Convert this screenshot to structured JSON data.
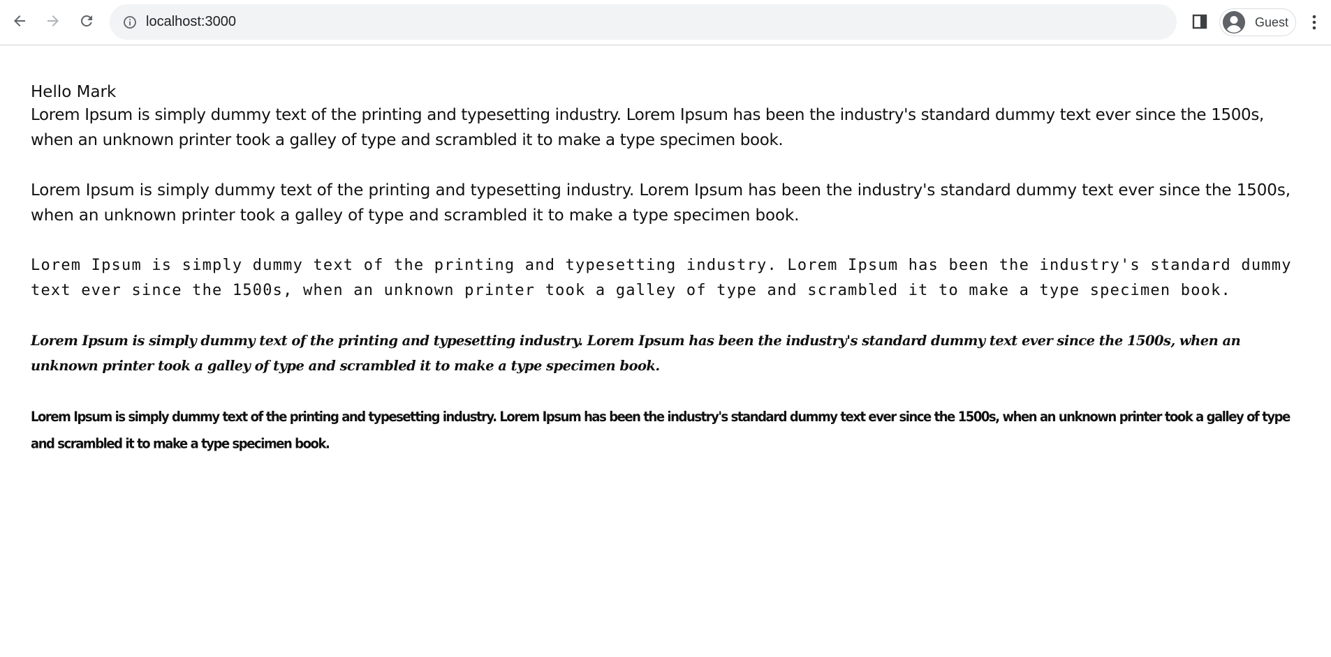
{
  "browser": {
    "url": "localhost:3000",
    "profile_label": "Guest",
    "icons": {
      "back": "arrow-left-icon",
      "forward": "arrow-right-icon",
      "reload": "reload-icon",
      "site_info": "info-icon",
      "side_panel": "side-panel-icon",
      "avatar": "person-icon",
      "menu": "three-dots-vertical-icon"
    },
    "colors": {
      "omnibox_bg": "#f1f3f4",
      "icon": "#5f6368",
      "icon_disabled": "#b0b3b8"
    }
  },
  "page": {
    "greeting": "Hello Mark",
    "paragraphs": [
      "Lorem Ipsum is simply dummy text of the printing and typesetting industry. Lorem Ipsum has been the industry's standard dummy text ever since the 1500s, when an unknown printer took a galley of type and scrambled it to make a type specimen book.",
      "Lorem Ipsum is simply dummy text of the printing and typesetting industry. Lorem Ipsum has been the industry's standard dummy text ever since the 1500s, when an unknown printer took a galley of type and scrambled it to make a type specimen book.",
      "Lorem Ipsum is simply dummy text of the printing and typesetting industry. Lorem Ipsum has been the industry's standard dummy text ever since the 1500s, when an unknown printer took a galley of type and scrambled it to make a type specimen book.",
      "Lorem Ipsum is simply dummy text of the printing and typesetting industry. Lorem Ipsum has been the industry's standard dummy text ever since the 1500s, when an unknown printer took a galley of type and scrambled it to make a type specimen book.",
      "Lorem Ipsum is simply dummy text of the printing and typesetting industry. Lorem Ipsum has been the industry's standard dummy text ever since the 1500s, when an unknown printer took a galley of type and scrambled it to make a type specimen book."
    ]
  }
}
